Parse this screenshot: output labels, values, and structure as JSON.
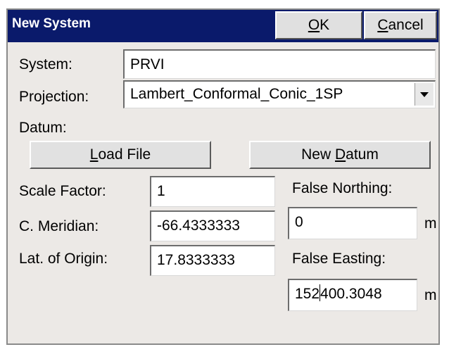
{
  "window": {
    "title": "New System",
    "ok_mnemonic": "O",
    "ok_rest": "K",
    "cancel_mnemonic": "C",
    "cancel_rest": "ancel"
  },
  "form": {
    "system_label": "System:",
    "system_value": "PRVI",
    "projection_label": "Projection:",
    "projection_value": "Lambert_Conformal_Conic_1SP",
    "datum_label": "Datum:",
    "load_file_mnemonic": "L",
    "load_file_rest": "oad File",
    "new_datum_prefix": "New ",
    "new_datum_mnemonic": "D",
    "new_datum_rest": "atum",
    "scale_factor_label": "Scale Factor:",
    "scale_factor_value": "1",
    "meridian_label": "C. Meridian:",
    "meridian_value": "-66.4333333",
    "lat_origin_label": "Lat. of Origin:",
    "lat_origin_value": "17.8333333",
    "false_northing_label": "False Northing:",
    "false_northing_value": "0",
    "false_northing_unit": "m",
    "false_easting_label": "False Easting:",
    "false_easting_before_caret": "152",
    "false_easting_after_caret": "400.3048",
    "false_easting_unit": "m"
  },
  "icons": {
    "dropdown": "chevron-down-icon"
  }
}
